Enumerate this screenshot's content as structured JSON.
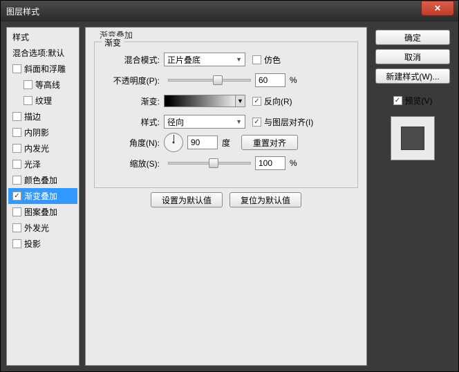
{
  "title": "图层样式",
  "sidebar": {
    "head1": "样式",
    "head2": "混合选项:默认",
    "items": [
      {
        "label": "斜面和浮雕",
        "checked": false
      },
      {
        "label": "等高线",
        "checked": false,
        "indent": true
      },
      {
        "label": "纹理",
        "checked": false,
        "indent": true
      },
      {
        "label": "描边",
        "checked": false
      },
      {
        "label": "内阴影",
        "checked": false
      },
      {
        "label": "内发光",
        "checked": false
      },
      {
        "label": "光泽",
        "checked": false
      },
      {
        "label": "颜色叠加",
        "checked": false
      },
      {
        "label": "渐变叠加",
        "checked": true,
        "selected": true
      },
      {
        "label": "图案叠加",
        "checked": false
      },
      {
        "label": "外发光",
        "checked": false
      },
      {
        "label": "投影",
        "checked": false
      }
    ]
  },
  "main": {
    "group_title": "渐变叠加",
    "fieldset_title": "渐变",
    "blend_label": "混合模式:",
    "blend_value": "正片叠底",
    "dither_label": "仿色",
    "opacity_label": "不透明度(P):",
    "opacity_value": "60",
    "percent": "%",
    "gradient_label": "渐变:",
    "reverse_label": "反向(R)",
    "style_label": "样式:",
    "style_value": "径向",
    "align_label": "与图层对齐(I)",
    "angle_label": "角度(N):",
    "angle_value": "90",
    "degree": "度",
    "reset_align": "重置对齐",
    "scale_label": "缩放(S):",
    "scale_value": "100",
    "set_default": "设置为默认值",
    "reset_default": "复位为默认值"
  },
  "right": {
    "ok": "确定",
    "cancel": "取消",
    "new_style": "新建样式(W)...",
    "preview_label": "预览(V)"
  }
}
